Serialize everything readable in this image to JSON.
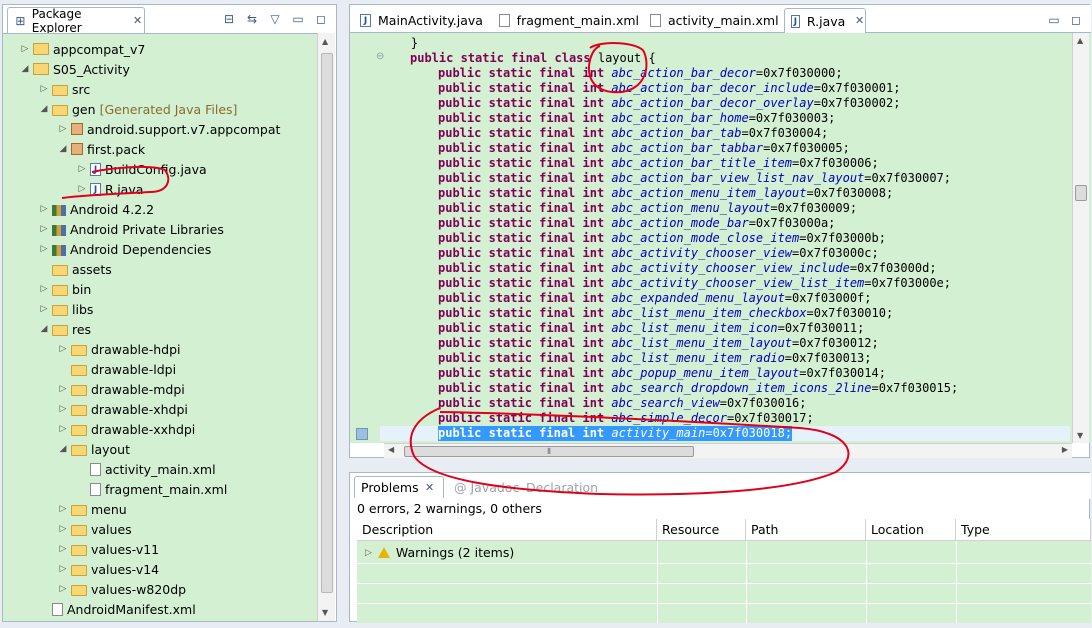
{
  "explorer": {
    "title": "Package Explorer",
    "items": [
      {
        "label": "appcompat_v7",
        "suffix": "",
        "indent": 0,
        "twisty": "▷",
        "icon": "project-icon"
      },
      {
        "label": "S05_Activity",
        "suffix": "",
        "indent": 0,
        "twisty": "◢",
        "icon": "project-icon"
      },
      {
        "label": "src",
        "suffix": "",
        "indent": 1,
        "twisty": "▷",
        "icon": "source-folder-icon"
      },
      {
        "label": "gen",
        "suffix": "[Generated Java Files]",
        "indent": 1,
        "twisty": "◢",
        "icon": "source-folder-icon"
      },
      {
        "label": "android.support.v7.appcompat",
        "suffix": "",
        "indent": 2,
        "twisty": "▷",
        "icon": "package-icon"
      },
      {
        "label": "first.pack",
        "suffix": "",
        "indent": 2,
        "twisty": "◢",
        "icon": "package-icon"
      },
      {
        "label": "BuildConfig.java",
        "suffix": "",
        "indent": 3,
        "twisty": "▷",
        "icon": "java-file-icon"
      },
      {
        "label": "R.java",
        "suffix": "",
        "indent": 3,
        "twisty": "▷",
        "icon": "java-file-icon"
      },
      {
        "label": "Android 4.2.2",
        "suffix": "",
        "indent": 1,
        "twisty": "▷",
        "icon": "library-icon"
      },
      {
        "label": "Android Private Libraries",
        "suffix": "",
        "indent": 1,
        "twisty": "▷",
        "icon": "library-icon"
      },
      {
        "label": "Android Dependencies",
        "suffix": "",
        "indent": 1,
        "twisty": "▷",
        "icon": "library-icon"
      },
      {
        "label": "assets",
        "suffix": "",
        "indent": 1,
        "twisty": "",
        "icon": "folder-icon"
      },
      {
        "label": "bin",
        "suffix": "",
        "indent": 1,
        "twisty": "▷",
        "icon": "folder-icon"
      },
      {
        "label": "libs",
        "suffix": "",
        "indent": 1,
        "twisty": "▷",
        "icon": "folder-icon"
      },
      {
        "label": "res",
        "suffix": "",
        "indent": 1,
        "twisty": "◢",
        "icon": "folder-icon"
      },
      {
        "label": "drawable-hdpi",
        "suffix": "",
        "indent": 2,
        "twisty": "▷",
        "icon": "folder-icon"
      },
      {
        "label": "drawable-ldpi",
        "suffix": "",
        "indent": 2,
        "twisty": "",
        "icon": "folder-icon"
      },
      {
        "label": "drawable-mdpi",
        "suffix": "",
        "indent": 2,
        "twisty": "▷",
        "icon": "folder-icon"
      },
      {
        "label": "drawable-xhdpi",
        "suffix": "",
        "indent": 2,
        "twisty": "▷",
        "icon": "folder-icon"
      },
      {
        "label": "drawable-xxhdpi",
        "suffix": "",
        "indent": 2,
        "twisty": "▷",
        "icon": "folder-icon"
      },
      {
        "label": "layout",
        "suffix": "",
        "indent": 2,
        "twisty": "◢",
        "icon": "folder-icon"
      },
      {
        "label": "activity_main.xml",
        "suffix": "",
        "indent": 3,
        "twisty": "",
        "icon": "xml-file-icon"
      },
      {
        "label": "fragment_main.xml",
        "suffix": "",
        "indent": 3,
        "twisty": "",
        "icon": "xml-file-icon"
      },
      {
        "label": "menu",
        "suffix": "",
        "indent": 2,
        "twisty": "▷",
        "icon": "folder-icon"
      },
      {
        "label": "values",
        "suffix": "",
        "indent": 2,
        "twisty": "▷",
        "icon": "folder-icon"
      },
      {
        "label": "values-v11",
        "suffix": "",
        "indent": 2,
        "twisty": "▷",
        "icon": "folder-icon"
      },
      {
        "label": "values-v14",
        "suffix": "",
        "indent": 2,
        "twisty": "▷",
        "icon": "folder-icon"
      },
      {
        "label": "values-w820dp",
        "suffix": "",
        "indent": 2,
        "twisty": "▷",
        "icon": "folder-icon"
      },
      {
        "label": "AndroidManifest.xml",
        "suffix": "",
        "indent": 1,
        "twisty": "",
        "icon": "xml-file-icon"
      }
    ]
  },
  "editor": {
    "tabs": [
      {
        "label": "MainActivity.java",
        "active": false
      },
      {
        "label": "fragment_main.xml",
        "active": false
      },
      {
        "label": "activity_main.xml",
        "active": false
      },
      {
        "label": "R.java",
        "active": true
      }
    ],
    "lines": [
      {
        "text": "    }",
        "kind": "plain"
      },
      {
        "text": "    public static final class layout {",
        "kind": "class"
      },
      {
        "field": "abc_action_bar_decor",
        "value": "0x7f030000"
      },
      {
        "field": "abc_action_bar_decor_include",
        "value": "0x7f030001"
      },
      {
        "field": "abc_action_bar_decor_overlay",
        "value": "0x7f030002"
      },
      {
        "field": "abc_action_bar_home",
        "value": "0x7f030003"
      },
      {
        "field": "abc_action_bar_tab",
        "value": "0x7f030004"
      },
      {
        "field": "abc_action_bar_tabbar",
        "value": "0x7f030005"
      },
      {
        "field": "abc_action_bar_title_item",
        "value": "0x7f030006"
      },
      {
        "field": "abc_action_bar_view_list_nav_layout",
        "value": "0x7f030007"
      },
      {
        "field": "abc_action_menu_item_layout",
        "value": "0x7f030008"
      },
      {
        "field": "abc_action_menu_layout",
        "value": "0x7f030009"
      },
      {
        "field": "abc_action_mode_bar",
        "value": "0x7f03000a"
      },
      {
        "field": "abc_action_mode_close_item",
        "value": "0x7f03000b"
      },
      {
        "field": "abc_activity_chooser_view",
        "value": "0x7f03000c"
      },
      {
        "field": "abc_activity_chooser_view_include",
        "value": "0x7f03000d"
      },
      {
        "field": "abc_activity_chooser_view_list_item",
        "value": "0x7f03000e"
      },
      {
        "field": "abc_expanded_menu_layout",
        "value": "0x7f03000f"
      },
      {
        "field": "abc_list_menu_item_checkbox",
        "value": "0x7f030010"
      },
      {
        "field": "abc_list_menu_item_icon",
        "value": "0x7f030011"
      },
      {
        "field": "abc_list_menu_item_layout",
        "value": "0x7f030012"
      },
      {
        "field": "abc_list_menu_item_radio",
        "value": "0x7f030013"
      },
      {
        "field": "abc_popup_menu_item_layout",
        "value": "0x7f030014"
      },
      {
        "field": "abc_search_dropdown_item_icons_2line",
        "value": "0x7f030015"
      },
      {
        "field": "abc_search_view",
        "value": "0x7f030016"
      },
      {
        "field": "abc_simple_decor",
        "value": "0x7f030017"
      },
      {
        "field": "activity_main",
        "value": "0x7f030018",
        "selected": true
      }
    ],
    "decl_prefix": "public static final int ",
    "class_line": {
      "keywords": "public static final class",
      "name": "layout",
      "brace": " {"
    }
  },
  "problems": {
    "tabs": [
      {
        "label": "Problems",
        "active": true
      },
      {
        "label": "@ Javadoc",
        "active": false
      },
      {
        "label": "Declaration",
        "active": false
      }
    ],
    "summary": "0 errors, 2 warnings, 0 others",
    "columns": [
      "Description",
      "Resource",
      "Path",
      "Location",
      "Type"
    ],
    "rows": [
      {
        "description": "Warnings (2 items)"
      }
    ]
  }
}
